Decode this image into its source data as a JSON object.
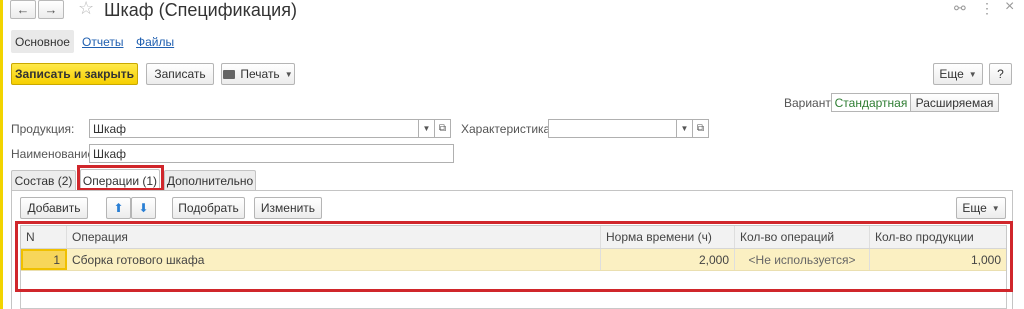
{
  "window": {
    "title": "Шкаф (Спецификация)",
    "back_glyph": "←",
    "forward_glyph": "→",
    "star_glyph": "☆",
    "link_glyph": "⚯",
    "more_glyph": "⋮",
    "close_glyph": "×"
  },
  "form_tabs": [
    "Основное",
    "Отчеты",
    "Файлы"
  ],
  "toolbar": {
    "save_close": "Записать и закрыть",
    "save": "Записать",
    "print": "Печать",
    "more": "Еще",
    "help": "?"
  },
  "variant": {
    "label": "Вариант:",
    "options": [
      "Стандартная",
      "Расширяемая"
    ],
    "selected": "Стандартная"
  },
  "fields": {
    "product_label": "Продукция:",
    "product_value": "Шкаф",
    "characteristic_label": "Характеристика:",
    "characteristic_value": "",
    "name_label": "Наименование:",
    "name_value": "Шкаф"
  },
  "inner_tabs": [
    "Состав (2)",
    "Операции (1)",
    "Дополнительно"
  ],
  "table_toolbar": {
    "add": "Добавить",
    "up_glyph": "⬆",
    "down_glyph": "⬇",
    "pick": "Подобрать",
    "change": "Изменить",
    "more": "Еще"
  },
  "table": {
    "columns": [
      "N",
      "Операция",
      "Норма времени (ч)",
      "Кол-во операций",
      "Кол-во продукции"
    ],
    "rows": [
      [
        "1",
        "Сборка готового шкафа",
        "2,000",
        "<Не используется>",
        "1,000"
      ]
    ]
  },
  "colors": {
    "accent_yellow": "#f6cf00",
    "highlight_red": "#d0262b",
    "row_selected": "#fbf0c2",
    "variant_active": "#2e7d32"
  }
}
